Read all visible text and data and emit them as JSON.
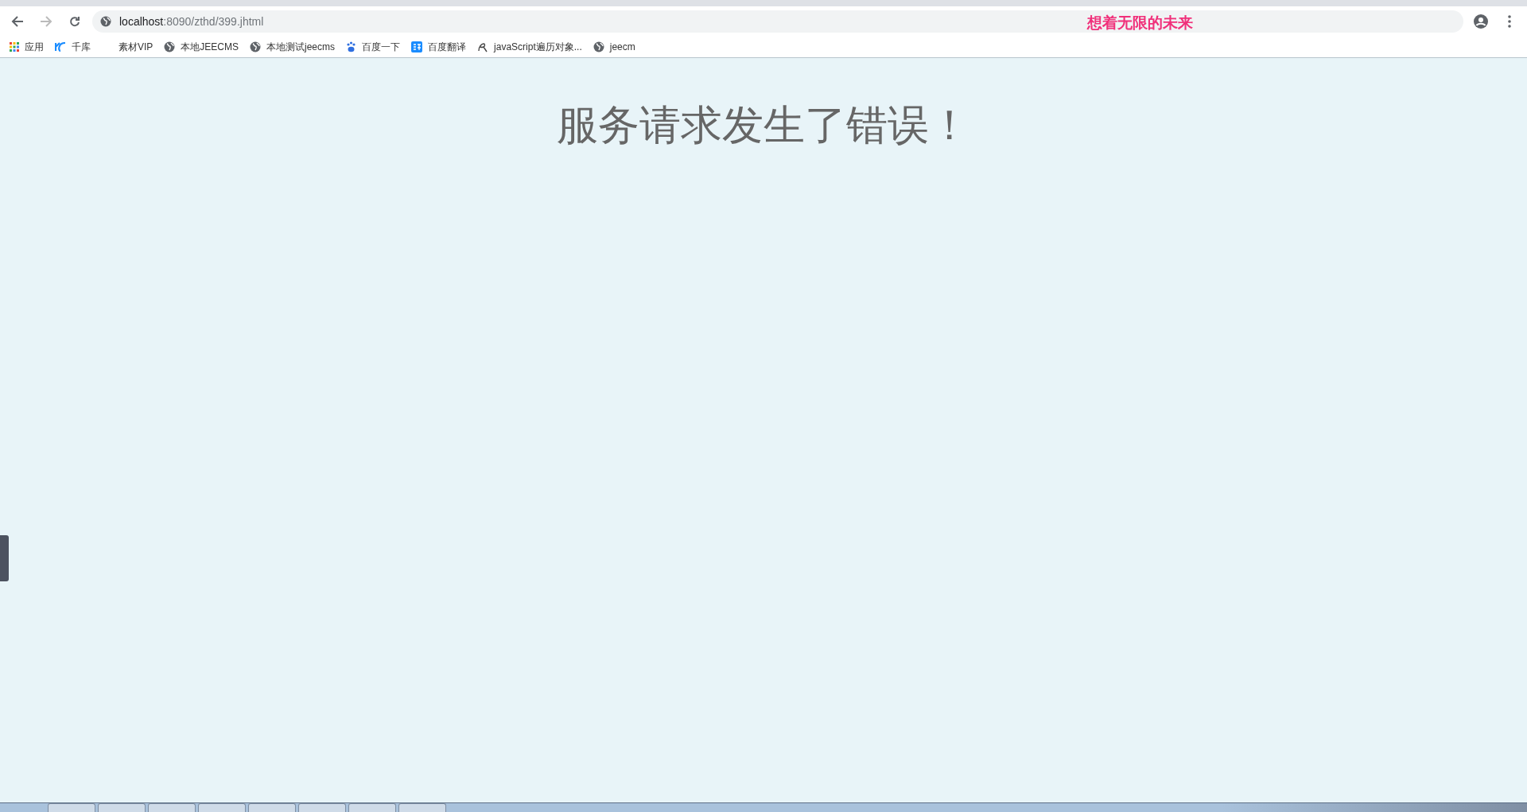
{
  "address_bar": {
    "host": "localhost",
    "path": ":8090/zthd/399.jhtml"
  },
  "overlay_text": "想着无限的未来",
  "bookmarks": [
    {
      "label": "应用",
      "kind": "apps"
    },
    {
      "label": "千库",
      "kind": "brand"
    },
    {
      "label": "素材VIP",
      "kind": "blank"
    },
    {
      "label": "本地JEECMS",
      "kind": "globe"
    },
    {
      "label": "本地测试jeecms",
      "kind": "globe"
    },
    {
      "label": "百度一下",
      "kind": "paw"
    },
    {
      "label": "百度翻译",
      "kind": "translate"
    },
    {
      "label": "javaScript遍历对象...",
      "kind": "script"
    },
    {
      "label": "jeecm",
      "kind": "globe"
    }
  ],
  "page": {
    "heading": "服务请求发生了错误！"
  }
}
